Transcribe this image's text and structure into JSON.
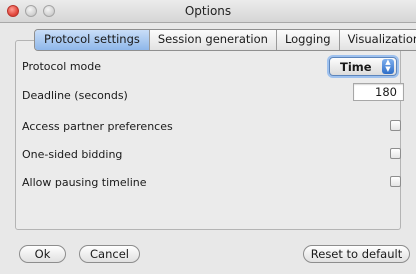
{
  "window": {
    "title": "Options"
  },
  "tabs": [
    {
      "label": "Protocol settings",
      "active": true
    },
    {
      "label": "Session generation",
      "active": false
    },
    {
      "label": "Logging",
      "active": false
    },
    {
      "label": "Visualization",
      "active": false
    }
  ],
  "settings": {
    "protocol_mode": {
      "label": "Protocol mode",
      "value": "Time"
    },
    "deadline": {
      "label": "Deadline (seconds)",
      "value": "180"
    },
    "access_partner_preferences": {
      "label": "Access partner preferences",
      "checked": false
    },
    "one_sided_bidding": {
      "label": "One-sided bidding",
      "checked": false
    },
    "allow_pausing_timeline": {
      "label": "Allow pausing timeline",
      "checked": false
    }
  },
  "buttons": {
    "ok": "Ok",
    "cancel": "Cancel",
    "reset": "Reset to default"
  },
  "colors": {
    "accent": "#8fb7ea",
    "close": "#e0443a"
  }
}
